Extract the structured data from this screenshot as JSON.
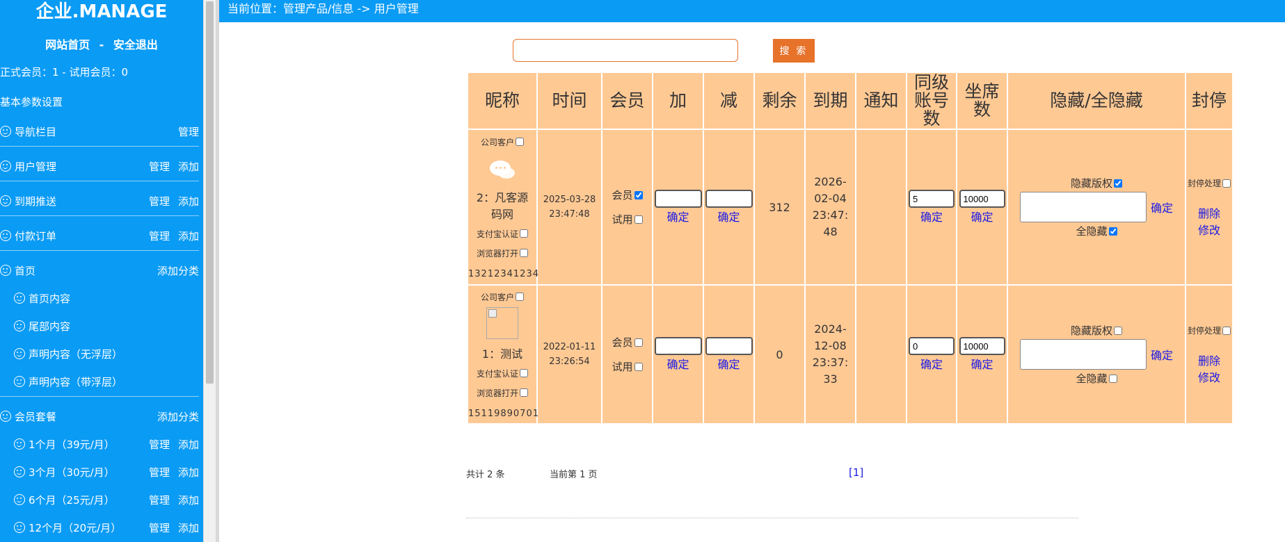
{
  "brand": "企业.MANAGE",
  "topnav": {
    "home": "网站首页",
    "sep": "-",
    "logout": "安全退出"
  },
  "stats": "正式会员：1  -  试用会员：0",
  "basic_settings": "基本参数设置",
  "menu": [
    {
      "label": "导航栏目",
      "actions": [
        "管理"
      ],
      "sub": false
    },
    {
      "label": "用户管理",
      "actions": [
        "管理",
        "添加"
      ],
      "sub": false
    },
    {
      "label": "到期推送",
      "actions": [
        "管理",
        "添加"
      ],
      "sub": false
    },
    {
      "label": "付款订单",
      "actions": [
        "管理",
        "添加"
      ],
      "sub": false
    },
    {
      "label": "首页",
      "actions": [
        "添加分类"
      ],
      "sub": false
    },
    {
      "label": "首页内容",
      "actions": [],
      "sub": true
    },
    {
      "label": "尾部内容",
      "actions": [],
      "sub": true
    },
    {
      "label": "声明内容（无浮层）",
      "actions": [],
      "sub": true
    },
    {
      "label": "声明内容（带浮层）",
      "actions": [],
      "sub": true
    },
    {
      "label": "会员套餐",
      "actions": [
        "添加分类"
      ],
      "sub": false
    },
    {
      "label": "1个月（39元/月）",
      "actions": [
        "管理",
        "添加"
      ],
      "sub": true
    },
    {
      "label": "3个月（30元/月）",
      "actions": [
        "管理",
        "添加"
      ],
      "sub": true
    },
    {
      "label": "6个月（25元/月）",
      "actions": [
        "管理",
        "添加"
      ],
      "sub": true
    },
    {
      "label": "12个月（20元/月）",
      "actions": [
        "管理",
        "添加"
      ],
      "sub": true
    }
  ],
  "breadcrumb": "当前位置：管理产品/信息 -> 用户管理",
  "search": {
    "placeholder": "",
    "button": "搜 索"
  },
  "table": {
    "headers": [
      "昵称",
      "时间",
      "会员",
      "加",
      "减",
      "剩余",
      "到期",
      "通知",
      "同级账号数",
      "坐席数",
      "隐藏/全隐藏",
      "封停"
    ],
    "labels": {
      "company": "公司客户",
      "alipay": "支付宝认证",
      "browser": "浏览器打开",
      "member": "会员",
      "trial": "试用",
      "confirm": "确定",
      "hide_copyright": "隐藏版权",
      "hide_all": "全隐藏",
      "ban": "封停处理",
      "delete": "删除",
      "edit": "修改"
    },
    "rows": [
      {
        "nickname": "2：凡客源码网",
        "phone": "13212341234",
        "icon": "chat-bubble-icon",
        "date": "2025-03-28",
        "time": "23:47:48",
        "member": true,
        "trial": false,
        "remaining": "312",
        "expire": "2026-02-04 23:47:48",
        "notify": "",
        "same_level": "5",
        "seats": "10000",
        "hide_copyright": true,
        "hide_all": true,
        "ban": false
      },
      {
        "nickname": "1：测试",
        "phone": "15119890701",
        "icon": "broken-image-icon",
        "date": "2022-01-11",
        "time": "23:26:54",
        "member": false,
        "trial": false,
        "remaining": "0",
        "expire": "2024-12-08 23:37:33",
        "notify": "",
        "same_level": "0",
        "seats": "10000",
        "hide_copyright": false,
        "hide_all": false,
        "ban": false
      }
    ]
  },
  "pagination": {
    "total": "共计 2 条",
    "current": "当前第 1 页",
    "page": "[1]"
  },
  "colors": {
    "primary": "#0a9bf5",
    "accent": "#e7722a",
    "table_bg": "#ffc994",
    "link": "#1a1ae6"
  }
}
